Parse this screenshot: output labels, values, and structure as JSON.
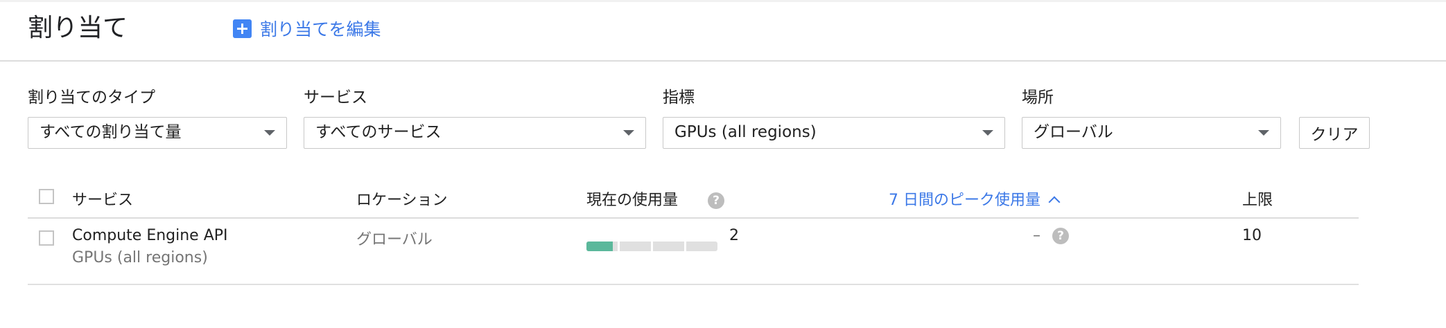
{
  "header": {
    "title": "割り当て",
    "edit_label": "割り当てを編集"
  },
  "filters": {
    "quota_type": {
      "label": "割り当てのタイプ",
      "value": "すべての割り当て量"
    },
    "service": {
      "label": "サービス",
      "value": "すべてのサービス"
    },
    "metric": {
      "label": "指標",
      "value": "GPUs (all regions)"
    },
    "location": {
      "label": "場所",
      "value": "グローバル"
    },
    "clear_label": "クリア"
  },
  "table": {
    "columns": {
      "service": "サービス",
      "location": "ロケーション",
      "current_usage": "現在の使用量",
      "peak_usage": "7 日間のピーク使用量",
      "limit": "上限"
    },
    "rows": [
      {
        "service": "Compute Engine API",
        "metric": "GPUs (all regions)",
        "location": "グローバル",
        "current_usage": "2",
        "usage_fraction": 0.2,
        "peak_usage": "–",
        "limit": "10"
      }
    ]
  },
  "icons": {
    "help": "?"
  },
  "colors": {
    "accent": "#3b78e7",
    "plus_icon": "#4285f4",
    "usage_fill": "#5bb89b"
  }
}
